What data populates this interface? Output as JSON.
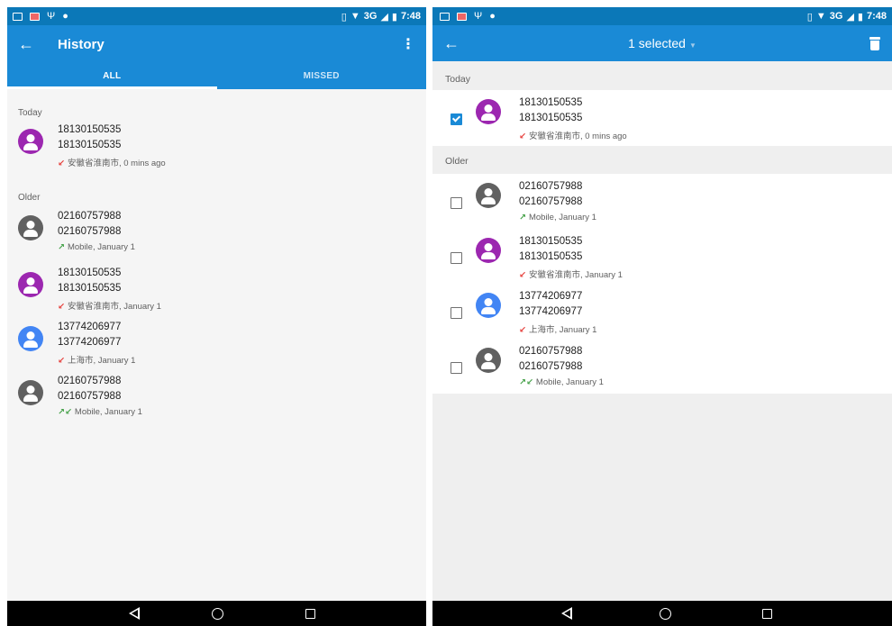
{
  "left": {
    "status": {
      "time": "7:48",
      "network": "3G"
    },
    "app_title": "History",
    "tabs": [
      {
        "label": "ALL"
      },
      {
        "label": "MISSED"
      }
    ],
    "sections": {
      "today": "Today",
      "older": "Older"
    },
    "items": [
      {
        "name": "18130150535",
        "number": "18130150535",
        "detail": "安徽省淮南市, 0 mins ago",
        "avatar_color": "#9c27b0",
        "arrows": "↙",
        "arrow_color": "#e53935"
      },
      {
        "name": "02160757988",
        "number": "02160757988",
        "detail": "Mobile, January 1",
        "avatar_color": "#616161",
        "arrows": "↗",
        "arrow_color": "#43a047"
      },
      {
        "name": "18130150535",
        "number": "18130150535",
        "detail": "安徽省淮南市, January 1",
        "avatar_color": "#9c27b0",
        "arrows": "↙",
        "arrow_color": "#e53935"
      },
      {
        "name": "13774206977",
        "number": "13774206977",
        "detail": "上海市, January 1",
        "avatar_color": "#4285f4",
        "arrows": "↙",
        "arrow_color": "#e53935"
      },
      {
        "name": "02160757988",
        "number": "02160757988",
        "detail": "Mobile, January 1",
        "avatar_color": "#616161",
        "arrows": "↗↙",
        "arrow_color": "#43a047"
      }
    ]
  },
  "right": {
    "status": {
      "time": "7:48",
      "network": "3G"
    },
    "selected_label": "1 selected",
    "sections": {
      "today": "Today",
      "older": "Older"
    },
    "items": [
      {
        "name": "18130150535",
        "number": "18130150535",
        "detail": "安徽省淮南市, 0 mins ago",
        "avatar_color": "#9c27b0",
        "arrows": "↙",
        "arrow_color": "#e53935",
        "checked": true
      },
      {
        "name": "02160757988",
        "number": "02160757988",
        "detail": "Mobile, January 1",
        "avatar_color": "#616161",
        "arrows": "↗",
        "arrow_color": "#43a047",
        "checked": false
      },
      {
        "name": "18130150535",
        "number": "18130150535",
        "detail": "安徽省淮南市, January 1",
        "avatar_color": "#9c27b0",
        "arrows": "↙",
        "arrow_color": "#e53935",
        "checked": false
      },
      {
        "name": "13774206977",
        "number": "13774206977",
        "detail": "上海市, January 1",
        "avatar_color": "#4285f4",
        "arrows": "↙",
        "arrow_color": "#e53935",
        "checked": false
      },
      {
        "name": "02160757988",
        "number": "02160757988",
        "detail": "Mobile, January 1",
        "avatar_color": "#616161",
        "arrows": "↗↙",
        "arrow_color": "#43a047",
        "checked": false
      }
    ]
  },
  "colors": {
    "status_bar": "#0b78b8",
    "app_bar": "#1a8ad6",
    "nav_bar": "#000000"
  },
  "icons": {
    "back": "arrow-left-icon",
    "overflow": "more-vert-icon",
    "delete": "trash-icon",
    "contact": "person-icon",
    "nav_back": "triangle-back-icon",
    "nav_home": "circle-home-icon",
    "nav_recent": "square-recents-icon"
  }
}
